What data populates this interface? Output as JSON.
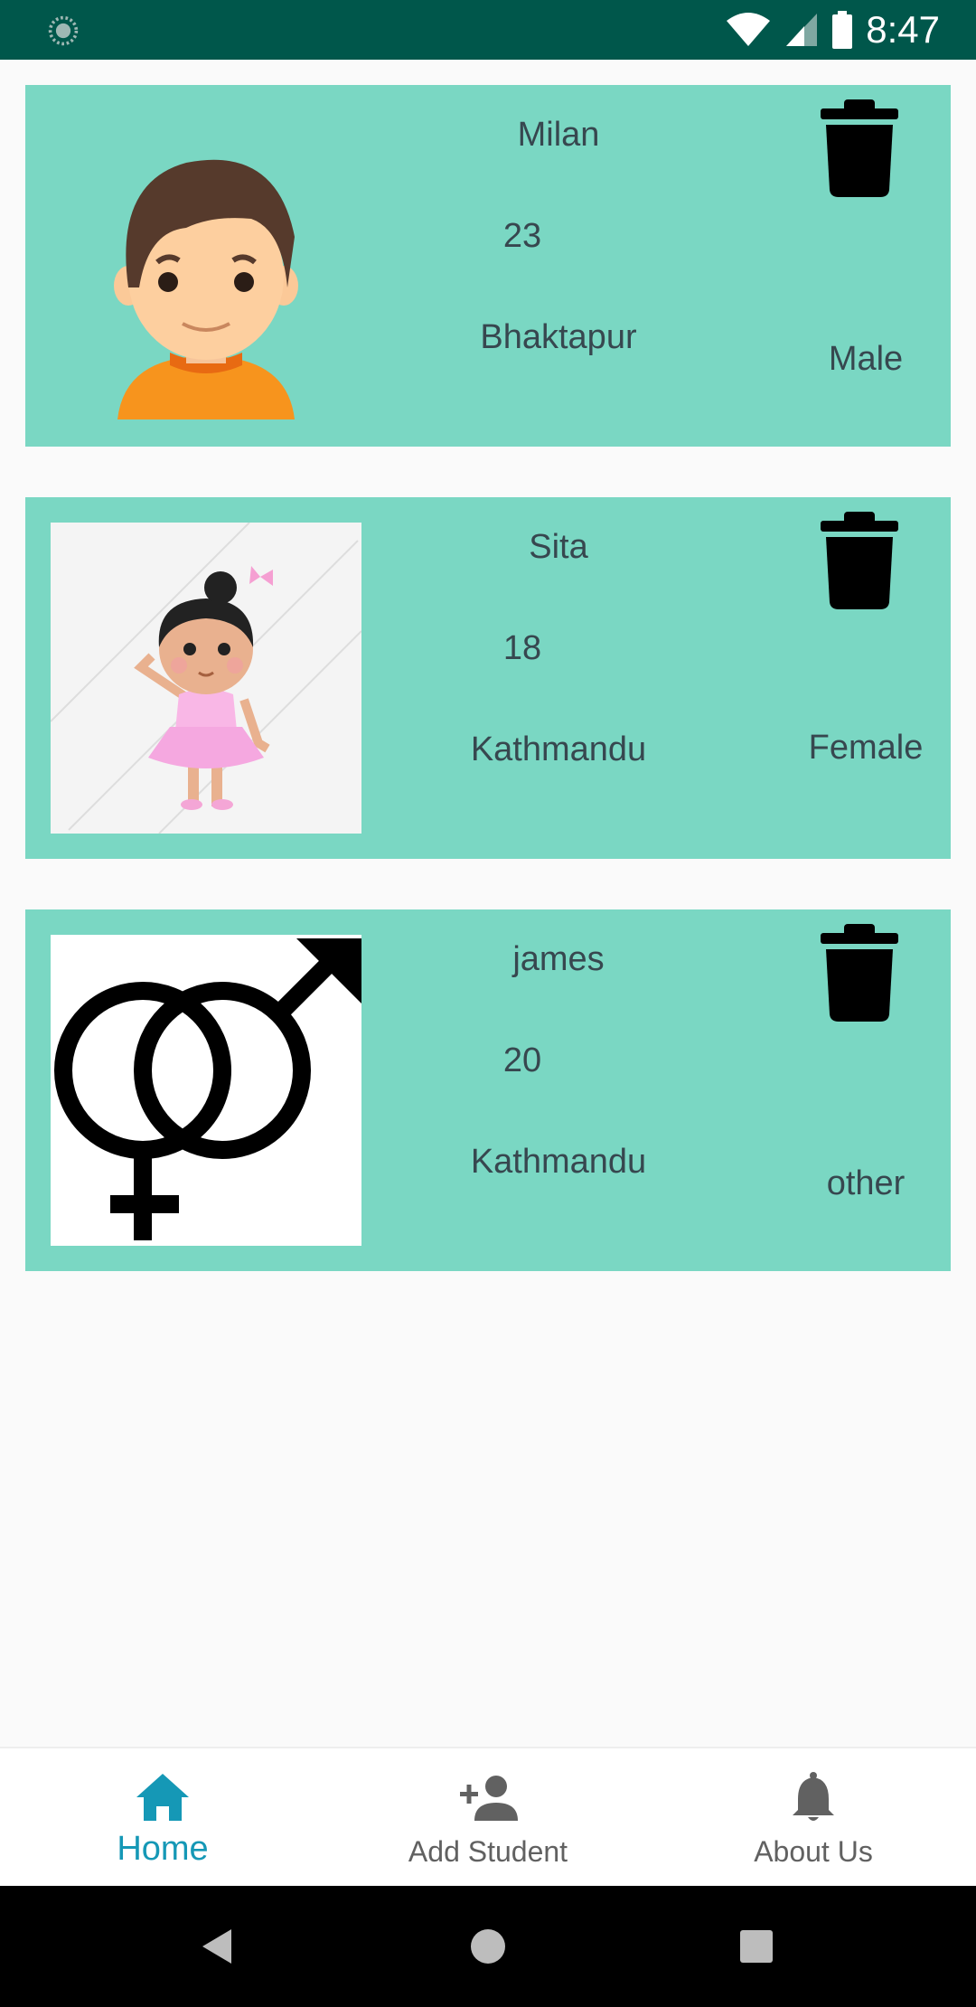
{
  "status_bar": {
    "time": "8:47",
    "icons": [
      "app-notification-icon",
      "wifi-icon",
      "cellular-signal-icon",
      "battery-icon"
    ]
  },
  "students": [
    {
      "name": "Milan",
      "age": "23",
      "address": "Bhaktapur",
      "gender": "Male",
      "avatar": "boy-avatar"
    },
    {
      "name": "Sita",
      "age": "18",
      "address": "Kathmandu",
      "gender": "Female",
      "avatar": "girl-avatar"
    },
    {
      "name": "james",
      "age": "20",
      "address": "Kathmandu",
      "gender": "other",
      "avatar": "gender-symbol"
    }
  ],
  "bottom_nav": {
    "items": [
      {
        "label": "Home",
        "icon": "home-icon",
        "active": true
      },
      {
        "label": "Add Student",
        "icon": "add-person-icon",
        "active": false
      },
      {
        "label": "About Us",
        "icon": "bell-icon",
        "active": false
      }
    ]
  },
  "colors": {
    "status_bar": "#00574b",
    "card": "#7ad7c3",
    "accent": "#1598b6",
    "text": "#37474f",
    "nav_inactive": "#616161"
  }
}
